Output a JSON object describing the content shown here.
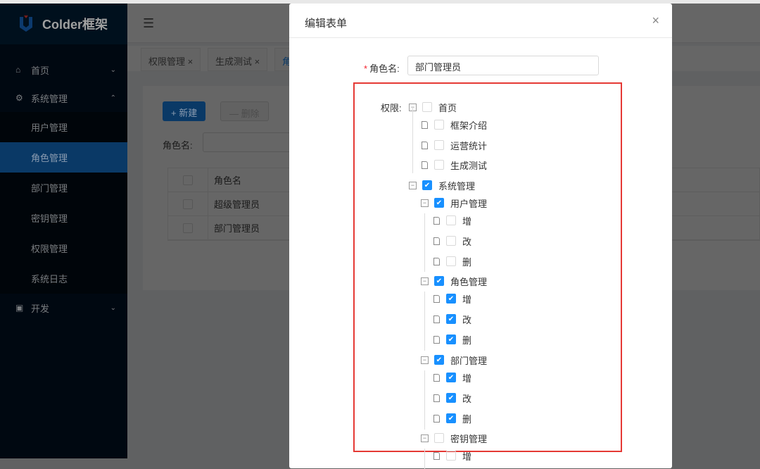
{
  "app": {
    "title": "Colder框架"
  },
  "sidebar": {
    "items": [
      {
        "label": "首页",
        "icon": "home-icon",
        "chevron": "⌄"
      },
      {
        "label": "系统管理",
        "icon": "gear-icon",
        "chevron": "⌃"
      },
      {
        "label": "开发",
        "icon": "code-icon",
        "chevron": "⌄"
      }
    ],
    "sub": [
      "用户管理",
      "角色管理",
      "部门管理",
      "密钥管理",
      "权限管理",
      "系统日志"
    ],
    "active": "角色管理"
  },
  "tabs": [
    "权限管理 ×",
    "生成测试 ×",
    "角"
  ],
  "page": {
    "new_label": "+  新建",
    "delete_label": "—  删除",
    "filter_label": "角色名:",
    "table_header": "角色名",
    "rows": [
      "超级管理员",
      "部门管理员"
    ]
  },
  "modal": {
    "title": "编辑表单",
    "close": "×",
    "role_label": "角色名:",
    "required": "*",
    "role_value": "部门管理员",
    "perm_label": "权限:",
    "tree": [
      {
        "label": "首页",
        "level": 0,
        "parent": true,
        "checked": false
      },
      {
        "label": "框架介绍",
        "level": 1,
        "parent": false,
        "checked": false
      },
      {
        "label": "运营统计",
        "level": 1,
        "parent": false,
        "checked": false
      },
      {
        "label": "生成测试",
        "level": 1,
        "parent": false,
        "checked": false
      },
      {
        "label": "系统管理",
        "level": 0,
        "parent": true,
        "checked": true
      },
      {
        "label": "用户管理",
        "level": 1,
        "parent": true,
        "checked": true
      },
      {
        "label": "增",
        "level": 2,
        "parent": false,
        "checked": false
      },
      {
        "label": "改",
        "level": 2,
        "parent": false,
        "checked": false
      },
      {
        "label": "删",
        "level": 2,
        "parent": false,
        "checked": false
      },
      {
        "label": "角色管理",
        "level": 1,
        "parent": true,
        "checked": true
      },
      {
        "label": "增",
        "level": 2,
        "parent": false,
        "checked": true
      },
      {
        "label": "改",
        "level": 2,
        "parent": false,
        "checked": true
      },
      {
        "label": "删",
        "level": 2,
        "parent": false,
        "checked": true
      },
      {
        "label": "部门管理",
        "level": 1,
        "parent": true,
        "checked": true
      },
      {
        "label": "增",
        "level": 2,
        "parent": false,
        "checked": true
      },
      {
        "label": "改",
        "level": 2,
        "parent": false,
        "checked": true
      },
      {
        "label": "删",
        "level": 2,
        "parent": false,
        "checked": true
      },
      {
        "label": "密钥管理",
        "level": 1,
        "parent": true,
        "checked": false
      },
      {
        "label": "增",
        "level": 2,
        "parent": false,
        "checked": false
      }
    ]
  },
  "colors": {
    "primary": "#1890ff",
    "sidebar": "#001529",
    "highlight": "#e53935"
  }
}
